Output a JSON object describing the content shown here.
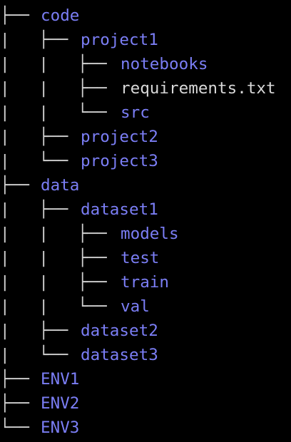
{
  "colors": {
    "background": "#000000",
    "directory": "#7b7ef5",
    "file": "#d8d8d8",
    "tree_lines": "#cfcfcf"
  },
  "tree": [
    {
      "prefix": "├── ",
      "name": "code",
      "kind": "dir",
      "depth": 0
    },
    {
      "prefix": "|   ├── ",
      "name": "project1",
      "kind": "dir",
      "depth": 1
    },
    {
      "prefix": "|   |   ├── ",
      "name": "notebooks",
      "kind": "dir",
      "depth": 2
    },
    {
      "prefix": "|   |   ├── ",
      "name": "requirements.txt",
      "kind": "file",
      "depth": 2
    },
    {
      "prefix": "|   |   └── ",
      "name": "src",
      "kind": "dir",
      "depth": 2
    },
    {
      "prefix": "|   ├── ",
      "name": "project2",
      "kind": "dir",
      "depth": 1
    },
    {
      "prefix": "|   └── ",
      "name": "project3",
      "kind": "dir",
      "depth": 1
    },
    {
      "prefix": "├── ",
      "name": "data",
      "kind": "dir",
      "depth": 0
    },
    {
      "prefix": "|   ├── ",
      "name": "dataset1",
      "kind": "dir",
      "depth": 1
    },
    {
      "prefix": "|   |   ├── ",
      "name": "models",
      "kind": "dir",
      "depth": 2
    },
    {
      "prefix": "|   |   ├── ",
      "name": "test",
      "kind": "dir",
      "depth": 2
    },
    {
      "prefix": "|   |   ├── ",
      "name": "train",
      "kind": "dir",
      "depth": 2
    },
    {
      "prefix": "|   |   └── ",
      "name": "val",
      "kind": "dir",
      "depth": 2
    },
    {
      "prefix": "|   ├── ",
      "name": "dataset2",
      "kind": "dir",
      "depth": 1
    },
    {
      "prefix": "|   └── ",
      "name": "dataset3",
      "kind": "dir",
      "depth": 1
    },
    {
      "prefix": "├── ",
      "name": "ENV1",
      "kind": "dir",
      "depth": 0
    },
    {
      "prefix": "├── ",
      "name": "ENV2",
      "kind": "dir",
      "depth": 0
    },
    {
      "prefix": "└── ",
      "name": "ENV3",
      "kind": "dir",
      "depth": 0
    }
  ]
}
